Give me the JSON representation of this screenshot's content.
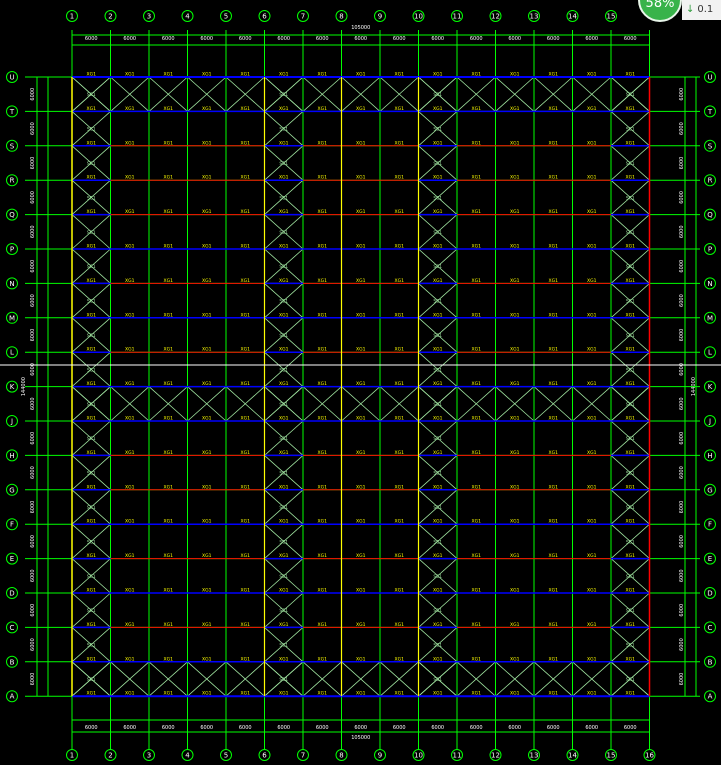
{
  "columns": [
    "1",
    "2",
    "3",
    "4",
    "5",
    "6",
    "7",
    "8",
    "9",
    "10",
    "11",
    "12",
    "13",
    "14",
    "15",
    "16"
  ],
  "rows": [
    "U",
    "T",
    "S",
    "R",
    "Q",
    "P",
    "N",
    "M",
    "L",
    "K",
    "J",
    "H",
    "G",
    "F",
    "E",
    "D",
    "C",
    "B",
    "A"
  ],
  "span_labels_top": [
    "6000",
    "6000",
    "6000",
    "6000",
    "6000",
    "6000",
    "6000",
    "6000",
    "6000",
    "6000",
    "6000",
    "6000",
    "6000",
    "6000",
    "6000"
  ],
  "span_labels_bottom": [
    "6000",
    "6000",
    "6000",
    "6000",
    "6000",
    "6000",
    "6000",
    "6000",
    "6000",
    "6000",
    "6000",
    "6000",
    "6000",
    "6000",
    "6000"
  ],
  "total_width_label": "105000",
  "total_height_label": "144000",
  "row_spacing_labels_left": [
    "6000",
    "6000",
    "6000",
    "6000",
    "6000",
    "6000",
    "6000",
    "6000",
    "6000",
    "6000",
    "6000",
    "6000",
    "6000",
    "6000",
    "6000",
    "6000",
    "6000",
    "6000"
  ],
  "row_spacing_labels_right": [
    "6000",
    "6000",
    "6000",
    "6000",
    "6000",
    "6000",
    "6000",
    "6000",
    "6000",
    "6000",
    "6000",
    "6000",
    "6000",
    "6000",
    "6000",
    "6000",
    "6000",
    "6000"
  ],
  "member_tag": "XG1",
  "brace_tag": "SC1",
  "overlay": {
    "progress_percent": "58%",
    "download_speed": "0.1",
    "download_icon": "arrow-down-icon"
  },
  "colors": {
    "grid": "#00ff00",
    "beam_blue": "#0000ff",
    "tie_red": "#ff0000",
    "column_yellow": "#ffff00",
    "brace": "#9fe39f",
    "text": "#ffffff",
    "tag": "#ffff00",
    "background": "#000000"
  }
}
